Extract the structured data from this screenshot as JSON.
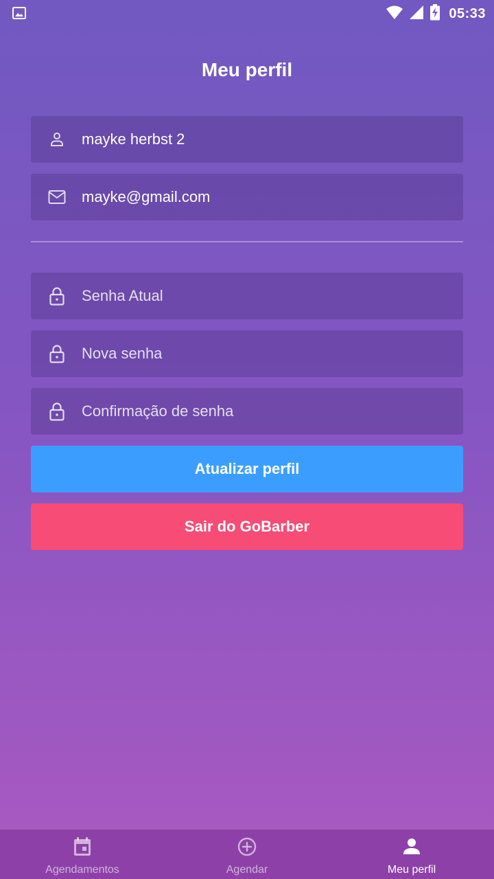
{
  "status_bar": {
    "time": "05:33",
    "left_icon": "image-icon",
    "right_icons": [
      "wifi-icon",
      "signal-icon",
      "battery-charging-icon"
    ]
  },
  "header": {
    "title": "Meu perfil"
  },
  "form": {
    "name": {
      "icon": "user-icon",
      "value": "mayke herbst 2"
    },
    "email": {
      "icon": "mail-icon",
      "value": "mayke@gmail.com"
    },
    "old_password": {
      "icon": "lock-icon",
      "placeholder": "Senha Atual"
    },
    "new_password": {
      "icon": "lock-icon",
      "placeholder": "Nova senha"
    },
    "confirm_password": {
      "icon": "lock-icon",
      "placeholder": "Confirmação de senha"
    },
    "update_button": "Atualizar perfil",
    "logout_button": "Sair do GoBarber"
  },
  "tabs": [
    {
      "label": "Agendamentos",
      "icon": "calendar-icon",
      "active": false
    },
    {
      "label": "Agendar",
      "icon": "add-circle-icon",
      "active": false
    },
    {
      "label": "Meu perfil",
      "icon": "person-icon",
      "active": true
    }
  ],
  "colors": {
    "background_top": "#7159c1",
    "background_bottom": "#ab59c1",
    "primary_button": "#3b9eff",
    "danger_button": "#f64c75",
    "tab_bar": "#8d41a8"
  }
}
